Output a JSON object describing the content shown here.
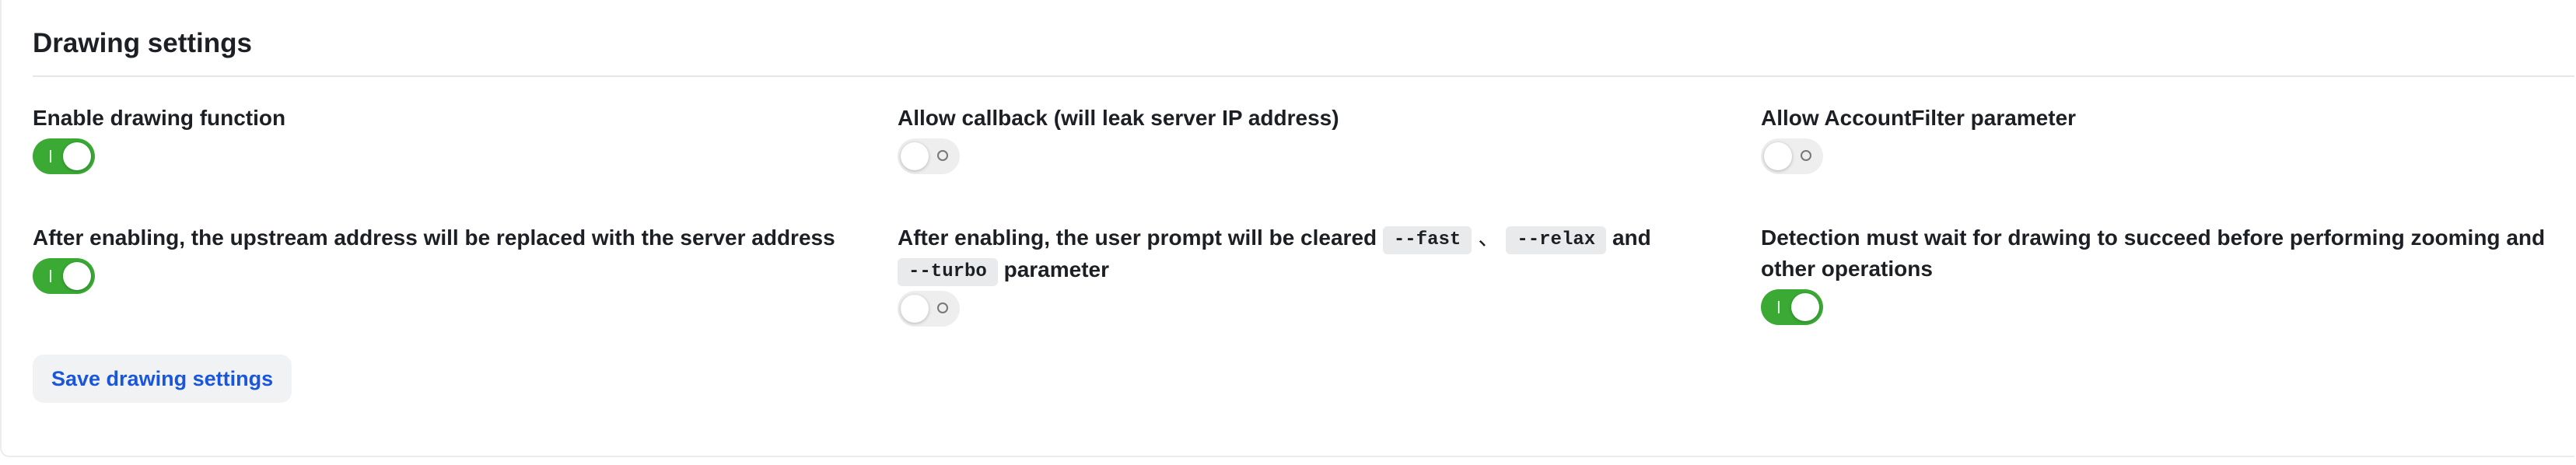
{
  "section": {
    "title": "Drawing settings"
  },
  "fields": {
    "enable_drawing": {
      "label": "Enable drawing function",
      "enabled": true
    },
    "allow_callback": {
      "label": "Allow callback (will leak server IP address)",
      "enabled": false
    },
    "allow_accountfilter": {
      "label": "Allow AccountFilter parameter",
      "enabled": false
    },
    "replace_upstream": {
      "label": "After enabling, the upstream address will be replaced with the server address",
      "enabled": true
    },
    "clear_prompt_params": {
      "label_prefix": "After enabling, the user prompt will be cleared",
      "code_fast": "--fast",
      "separator": "、",
      "code_relax": "--relax",
      "conjunction": "and",
      "code_turbo": "--turbo",
      "label_suffix": "parameter",
      "enabled": false
    },
    "wait_for_success": {
      "label": "Detection must wait for drawing to succeed before performing zooming and other operations",
      "enabled": true
    }
  },
  "actions": {
    "save_label": "Save drawing settings"
  },
  "colors": {
    "toggle_on": "#3aaa35",
    "toggle_off": "#eeeeee",
    "save_text": "#1a56db",
    "save_bg": "#f1f2f4"
  }
}
